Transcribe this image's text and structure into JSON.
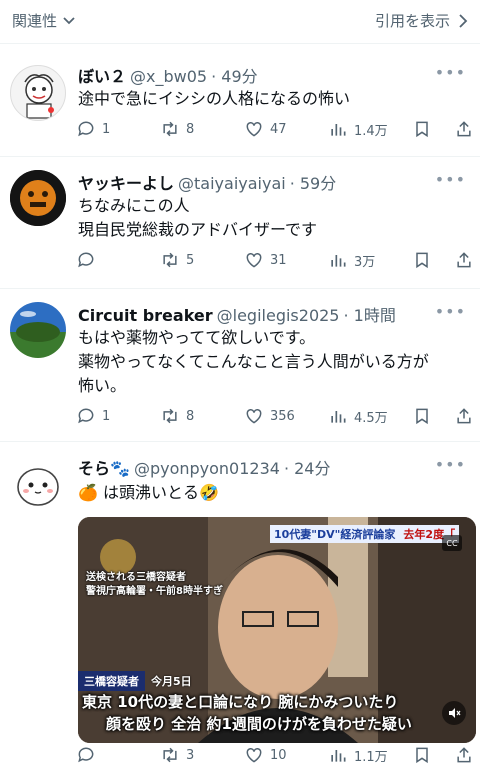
{
  "topbar": {
    "sort_label": "関連性",
    "quote_label": "引用を表示"
  },
  "tweets": [
    {
      "name": "ぼい２",
      "handle": "@x_bw05",
      "time": "· 49分",
      "lines": [
        "途中で急にイシシの人格になるの怖い"
      ],
      "replies": "1",
      "retweets": "8",
      "likes": "47",
      "views": "1.4万"
    },
    {
      "name": "ヤッキーよし",
      "handle": "@taiyaiyaiyai",
      "time": "· 59分",
      "lines": [
        "ちなみにこの人",
        "現自民党総裁のアドバイザーです"
      ],
      "replies": "",
      "retweets": "5",
      "likes": "31",
      "views": "3万"
    },
    {
      "name": "Circuit breaker",
      "handle": "@legilegis2025",
      "time": "· 1時間",
      "lines": [
        "もはや薬物やってて欲しいです。",
        "薬物やってなくてこんなこと言う人間がいる方が",
        "怖い。"
      ],
      "replies": "1",
      "retweets": "8",
      "likes": "356",
      "views": "4.5万"
    },
    {
      "name": "そら🐾",
      "handle": "@pyonpyon01234",
      "time": "· 24分",
      "lines": [
        "🍊 は頭沸いとる🤣"
      ],
      "replies": "",
      "retweets": "3",
      "likes": "10",
      "views": "1.1万"
    }
  ],
  "video": {
    "banner_top": "10代妻\"DV\"経済評論家",
    "banner_top_right": "去年2度「",
    "left_caption_1": "送検される三橋容疑者",
    "left_caption_2": "警視庁高輪署・午前8時半すぎ",
    "suspect_label": "三橋容疑者",
    "date_label": "今月5日",
    "subtitle_1": "東京 10代の妻と口論になり 腕にかみついたり",
    "subtitle_2": "顔を殴り 全治 約1週間のけがを負わせた疑い",
    "cc_label": "CC"
  }
}
